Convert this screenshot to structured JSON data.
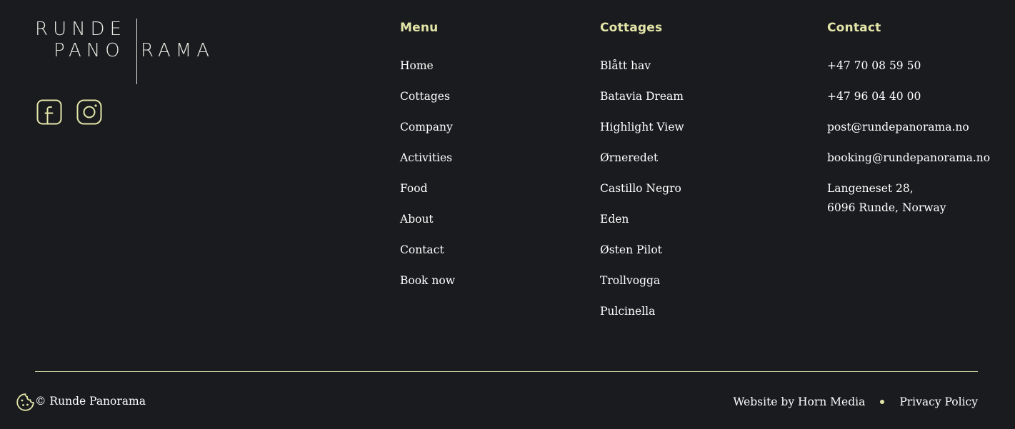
{
  "brand": {
    "logo_line1": "RUNDE",
    "logo_line2_left": "PANO",
    "logo_line2_right": "RAMA",
    "accent_color": "#e3e5a8",
    "background_color": "#1a1b1e"
  },
  "social": [
    {
      "icon": "facebook-icon"
    },
    {
      "icon": "instagram-icon"
    }
  ],
  "menu": {
    "title": "Menu",
    "items": [
      "Home",
      "Cottages",
      "Company",
      "Activities",
      "Food",
      "About",
      "Contact",
      "Book now"
    ]
  },
  "cottages": {
    "title": "Cottages",
    "items": [
      "Blått hav",
      "Batavia Dream",
      "Highlight View",
      "Ørneredet",
      "Castillo Negro",
      "Eden",
      "Østen Pilot",
      "Trollvogga",
      "Pulcinella"
    ]
  },
  "contact": {
    "title": "Contact",
    "phone1": "+47 70 08 59 50",
    "phone2": "+47 96 04 40 00",
    "email1": "post@rundepanorama.no",
    "email2": "booking@rundepanorama.no",
    "address_line1": "Langeneset 28,",
    "address_line2": "6096 Runde, Norway"
  },
  "footer": {
    "copyright": "© Runde Panorama",
    "website_by": "Website by Horn Media",
    "privacy": "Privacy Policy",
    "cookie_icon": "cookie-icon"
  }
}
